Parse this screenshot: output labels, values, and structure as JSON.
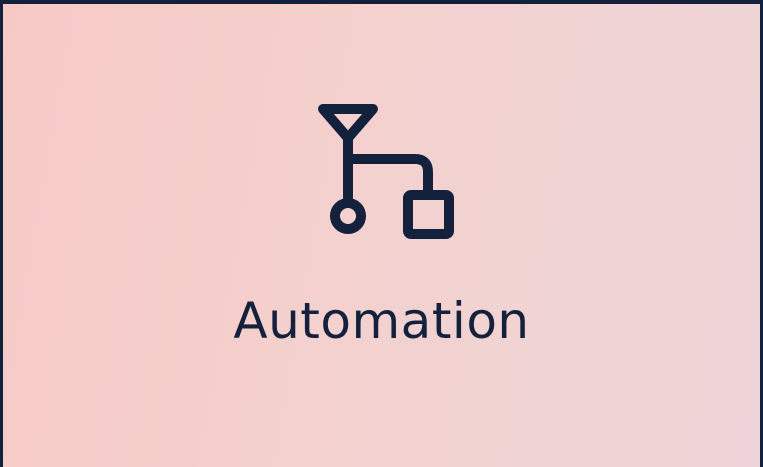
{
  "tile": {
    "label": "Automation",
    "icon": "workflow-branch-icon"
  },
  "colors": {
    "ink": "#14213d",
    "background_start": "#f6c9c6",
    "background_end": "#eed4d8"
  }
}
